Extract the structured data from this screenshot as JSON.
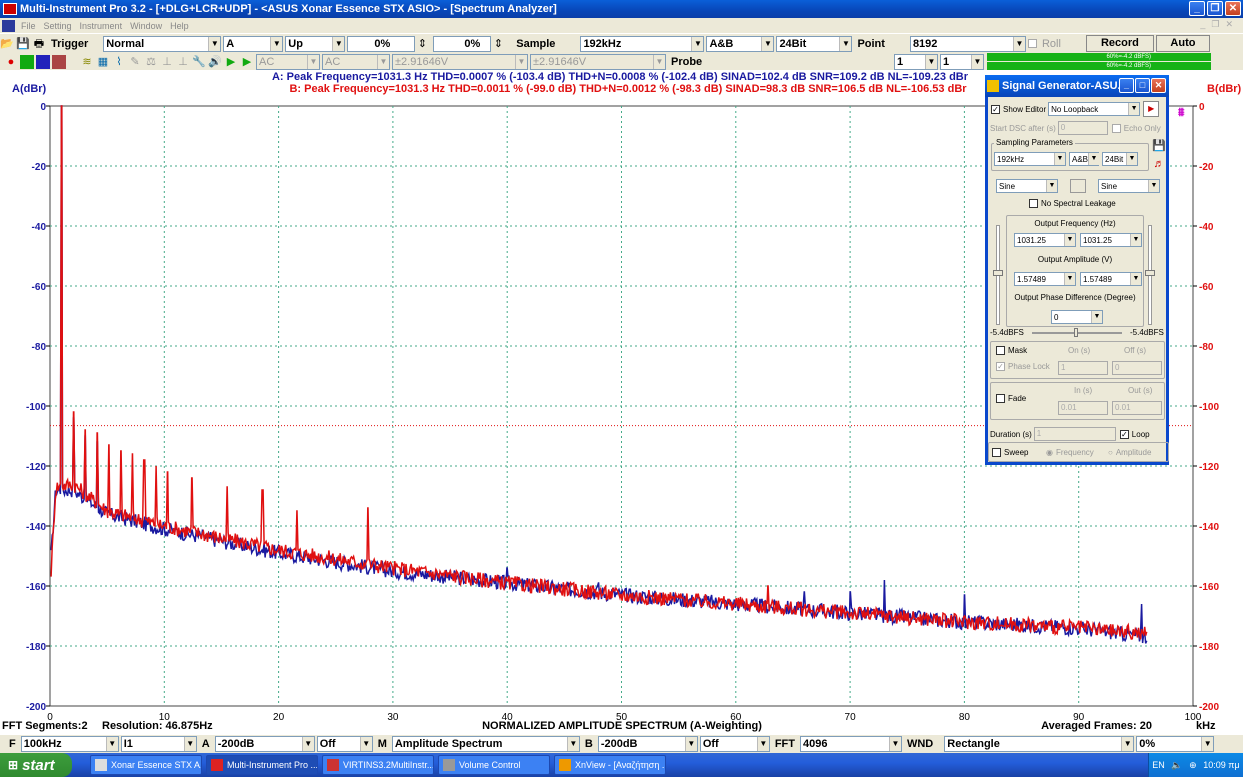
{
  "window": {
    "title": "Multi-Instrument Pro 3.2    - [+DLG+LCR+UDP]    - <ASUS Xonar Essence STX ASIO> - [Spectrum Analyzer]"
  },
  "menu": [
    "File",
    "Setting",
    "Instrument",
    "Window",
    "Help"
  ],
  "toolbar1": {
    "trigger_label": "Trigger",
    "trigger_mode": "Normal",
    "trigger_channel": "A",
    "trigger_edge": "Up",
    "trigger_level": "0%",
    "trigger_delay": "0%",
    "sample_label": "Sample",
    "sample_rate": "192kHz",
    "sample_channels": "A&B",
    "sample_bits": "24Bit",
    "point_label": "Point",
    "point_value": "8192",
    "roll_label": "Roll",
    "record_label": "Record",
    "auto_label": "Auto"
  },
  "toolbar2": {
    "coupling_a": "AC",
    "coupling_b": "AC",
    "range_a": "±2.91646V",
    "range_b": "±2.91646V",
    "probe_label": "Probe",
    "probe_a": "1",
    "probe_b": "1",
    "meter_a": "60%=-4.2 dBFS)",
    "meter_b": "60%=-4.2 dBFS)"
  },
  "measurements": {
    "a": "A: Peak Frequency=1031.3 Hz  THD=0.0007 % (-103.4 dB)  THD+N=0.0008 % (-102.4 dB)  SINAD=102.4 dB  SNR=109.2 dB  NL=-109.23 dBr",
    "b": "B: Peak Frequency=1031.3 Hz  THD=0.0011 % (-99.0 dB)  THD+N=0.0012 % (-98.3 dB)  SINAD=98.3 dB  SNR=106.5 dB  NL=-106.53 dBr"
  },
  "chart_data": {
    "type": "line",
    "title": "NORMALIZED AMPLITUDE SPECTRUM (A-Weighting)",
    "ylabel_left": "A(dBr)",
    "ylabel_right": "B(dBr)",
    "xunit": "kHz",
    "xlim": [
      0,
      100
    ],
    "ylim": [
      -200,
      0
    ],
    "xticks": [
      0,
      10,
      20,
      30,
      40,
      50,
      60,
      70,
      80,
      90,
      100
    ],
    "yticks": [
      0,
      -20,
      -40,
      -60,
      -80,
      -100,
      -120,
      -140,
      -160,
      -180,
      -200
    ],
    "grid": true,
    "series": [
      {
        "name": "A",
        "color": "#1a1aa0",
        "floor": [
          [
            0.1,
            -150
          ],
          [
            0.5,
            -128
          ],
          [
            2,
            -128
          ],
          [
            5,
            -136
          ],
          [
            10,
            -141
          ],
          [
            20,
            -149
          ],
          [
            30,
            -155
          ],
          [
            40,
            -159
          ],
          [
            50,
            -163
          ],
          [
            60,
            -166
          ],
          [
            70,
            -169
          ],
          [
            80,
            -172
          ],
          [
            90,
            -174
          ],
          [
            96,
            -177
          ]
        ],
        "peaks": [
          [
            1.031,
            0
          ],
          [
            2.06,
            -104
          ],
          [
            3.09,
            -110
          ],
          [
            4.12,
            -112
          ],
          [
            40,
            -154
          ],
          [
            48,
            -159
          ],
          [
            66,
            -162
          ],
          [
            70,
            -162
          ],
          [
            73,
            -158
          ],
          [
            80,
            -163
          ],
          [
            95.5,
            -166
          ]
        ]
      },
      {
        "name": "B",
        "color": "#e01010",
        "floor": [
          [
            0.1,
            -155
          ],
          [
            0.5,
            -127
          ],
          [
            2,
            -126
          ],
          [
            5,
            -135
          ],
          [
            10,
            -140
          ],
          [
            20,
            -148
          ],
          [
            30,
            -154
          ],
          [
            40,
            -159
          ],
          [
            50,
            -163
          ],
          [
            60,
            -166
          ],
          [
            70,
            -169
          ],
          [
            80,
            -172
          ],
          [
            90,
            -174
          ],
          [
            96,
            -176
          ]
        ],
        "peaks": [
          [
            1.031,
            0
          ],
          [
            2.06,
            -102
          ],
          [
            3.09,
            -108
          ],
          [
            4.12,
            -109
          ],
          [
            5.16,
            -113
          ],
          [
            6.19,
            -115
          ],
          [
            7.22,
            -116
          ],
          [
            8.25,
            -118
          ],
          [
            9.28,
            -120
          ],
          [
            10.3,
            -122
          ],
          [
            12.4,
            -124
          ],
          [
            15.5,
            -127
          ],
          [
            18.6,
            -128
          ],
          [
            21.6,
            -135
          ],
          [
            27.8,
            -134
          ],
          [
            47.5,
            -160
          ],
          [
            55,
            -163
          ],
          [
            62.8,
            -160
          ]
        ]
      }
    ],
    "reference_line": -106.53,
    "footer_left": "FFT Segments:2",
    "footer_resolution": "Resolution: 46.875Hz",
    "footer_right": "Averaged Frames: 20"
  },
  "statusbar": {
    "f_label": "F",
    "f_value": "100kHz",
    "scale": "I1",
    "a_label": "A",
    "a_range": "-200dB",
    "a_off": "Off",
    "m_label": "M",
    "m_value": "Amplitude Spectrum",
    "b_label": "B",
    "b_range": "-200dB",
    "b_off": "Off",
    "fft_label": "FFT",
    "fft_value": "4096",
    "wnd_label": "WND",
    "wnd_value": "Rectangle",
    "overlap": "0%"
  },
  "siggen": {
    "title": "Signal Generator-ASU...",
    "show_editor": "Show Editor",
    "loopback": "No Loopback",
    "start_dsc": "Start DSC after (s)",
    "start_dsc_value": "0",
    "echo_only": "Echo Only",
    "sampling_params": "Sampling Parameters",
    "rate": "192kHz",
    "channels": "A&B",
    "bits": "24Bit",
    "wave_a": "Sine",
    "wave_b": "Sine",
    "no_leakage": "No Spectral Leakage",
    "out_freq_label": "Output Frequency (Hz)",
    "freq_a": "1031.25",
    "freq_b": "1031.25",
    "out_amp_label": "Output Amplitude (V)",
    "amp_a": "1.57489",
    "amp_b": "1.57489",
    "phase_label": "Output Phase Difference (Degree)",
    "phase_value": "0",
    "dbfs_a": "-5.4dBFS",
    "dbfs_b": "-5.4dBFS",
    "mask": "Mask",
    "on_s": "On (s)",
    "off_s": "Off (s)",
    "phase_lock": "Phase Lock",
    "on_val": "1",
    "off_val": "0",
    "fade": "Fade",
    "in_s": "In (s)",
    "out_s": "Out (s)",
    "fade_in": "0.01",
    "fade_out": "0.01",
    "duration": "Duration (s)",
    "duration_value": "1",
    "loop": "Loop",
    "sweep": "Sweep",
    "frequency": "Frequency",
    "amplitude": "Amplitude"
  },
  "taskbar": {
    "start": "start",
    "tasks": [
      "Xonar Essence STX A...",
      "Multi-Instrument Pro ...",
      "VIRTINS3.2MultiInstr...",
      "Volume Control",
      "XnView - [Αναζήτηση ..."
    ],
    "lang": "EN",
    "clock": "10:09 πμ"
  }
}
